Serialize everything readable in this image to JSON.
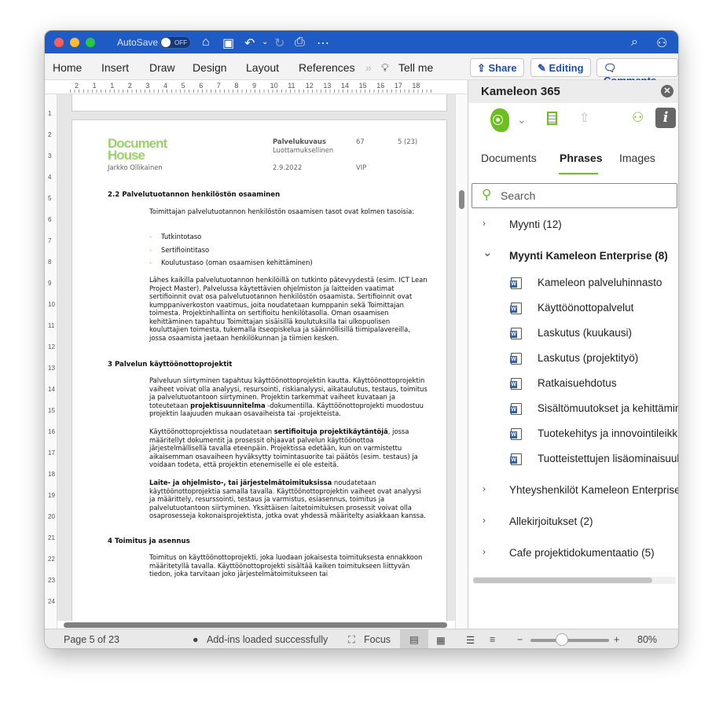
{
  "window": {
    "autosave_label": "AutoSave",
    "autosave_state": "OFF",
    "accent": "#1f5bc4"
  },
  "ribbon": {
    "tabs": [
      "Home",
      "Insert",
      "Draw",
      "Design",
      "Layout",
      "References"
    ],
    "tell_me": "Tell me",
    "share": "Share",
    "editing": "Editing",
    "comments": "Comments"
  },
  "ruler": {
    "ticks": [
      "2",
      "1",
      "1",
      "2",
      "3",
      "4",
      "5",
      "6",
      "7",
      "8",
      "9",
      "10",
      "11",
      "12",
      "13",
      "14",
      "15",
      "16",
      "17",
      "18"
    ]
  },
  "document": {
    "header": {
      "logo": "Document House",
      "author": "Jarkko Ollikainen",
      "doc_type": "Palvelukuvaus",
      "classification": "Luottamuksellinen",
      "date": "2.9.2022",
      "number": "67",
      "page": "5 (23)",
      "code": "VIP"
    },
    "h22": "2.2  Palvelutuotannon henkilöstön osaaminen",
    "p1": "Toimittajan palvelutuotannon henkilöstön osaamisen tasot ovat kolmen tasoisia:",
    "list": [
      "Tutkintotaso",
      "Sertifiointitaso",
      "Koulutustaso (oman osaamisen kehittäminen)"
    ],
    "p2": "Lähes kaikilla palvelutuotannon henkilöillä on tutkinto pätevyydestä (esim. ICT Lean Project Master). Palvelussa käytettävien ohjelmiston ja laitteiden vaatimat sertifioinnit ovat osa palvelutuotannon henkilöstön osaamista. Sertifioinnit ovat kumppaniverkoston vaatimus, joita noudatetaan kumppanin sekä Toimittajan toimesta. Projektinhallinta on sertifioitu henkilötasolla. Oman osaamisen kehittäminen tapahtuu Toimittajan sisäisillä koulutuksilla tai ulkopuolisen kouluttajien toimesta, tukemalla itseopiskelua ja säännöllisillä tiimipalavereilla, jossa osaamista jaetaan henkilökunnan ja tiimien kesken.",
    "h3": "3  Palvelun käyttöönottoprojektit",
    "p3a": "Palveluun siirtyminen tapahtuu käyttöönottoprojektin kautta. Käyttöönottoprojektin vaiheet voivat olla analyysi, resursointi, riskianalyysi, aikataulutus, testaus, toimitus ja palvelutuotantoon siirtyminen. Projektin tarkemmat vaiheet kuvataan ja toteutetaan ",
    "p3b": "projektisuunnitelma",
    "p3c": " -dokumentilla. Käyttöönottoprojekti muodostuu projektin laajuuden mukaan osavaiheista tai -projekteista.",
    "p4a": "Käyttöönottoprojektissa noudatetaan ",
    "p4b": "sertifioituja projektikäytäntöjä",
    "p4c": ", jossa määritellyt dokumentit ja prosessit ohjaavat palvelun käyttöönottoa järjestelmällisellä tavalla eteenpäin. Projektissa edetään, kun on varmistettu aikaisemman osavaiheen hyväksytty toimintasuorite tai päätös (esim. testaus) ja voidaan todeta, että projektin etenemiselle ei ole esteitä.",
    "p5a": "Laite- ja ohjelmisto-, tai järjestelmätoimituksissa",
    "p5b": " noudatetaan käyttöönottoprojektia samalla tavalla. Käyttöönottoprojektin vaiheet ovat analyysi ja määrittely, resurssointi, testaus ja varmistus, esiasennus, toimitus ja palvelutuotantoon siirtyminen. Yksittäisen laitetoimituksen prosessit voivat olla osaprosesseja kokonaisprojektista, jotka ovat yhdessä määritelty asiakkaan kanssa.",
    "h4": "4  Toimitus ja asennus",
    "p6": "Toimitus on käyttöönottoprojekti, joka luodaan jokaisesta toimituksesta ennakkoon määritetyllä tavalla. Käyttöönottoprojekti sisältää kaiken toimitukseen liittyvän tiedon, joka tarvitaan joko järjestelmätoimitukseen tai"
  },
  "status": {
    "page": "Page 5 of 23",
    "addins": "Add-ins loaded successfully",
    "focus": "Focus",
    "zoom": "80%",
    "zoom_percent": 80
  },
  "panel": {
    "title": "Kameleon 365",
    "tabs": [
      "Documents",
      "Phrases",
      "Images"
    ],
    "active_tab": "Phrases",
    "accent": "#6bbf1f",
    "search_placeholder": "Search",
    "groups": [
      {
        "label": "Myynti (12)",
        "expanded": false
      },
      {
        "label": "Myynti Kameleon Enterprise (8)",
        "expanded": true,
        "items": [
          "Kameleon palveluhinnasto",
          "Käyttöönottopalvelut",
          "Laskutus (kuukausi)",
          "Laskutus (projektityö)",
          "Ratkaisuehdotus",
          "Sisältömuutokset ja kehittäminen",
          "Tuotekehitys ja innovointileikki",
          "Tuotteistettujen lisäominaisuuksien"
        ]
      },
      {
        "label": "Yhteyshenkilöt Kameleon Enterprise",
        "expanded": false
      },
      {
        "label": "Allekirjoitukset (2)",
        "expanded": false
      },
      {
        "label": "Cafe projektidokumentaatio (5)",
        "expanded": false
      }
    ]
  }
}
